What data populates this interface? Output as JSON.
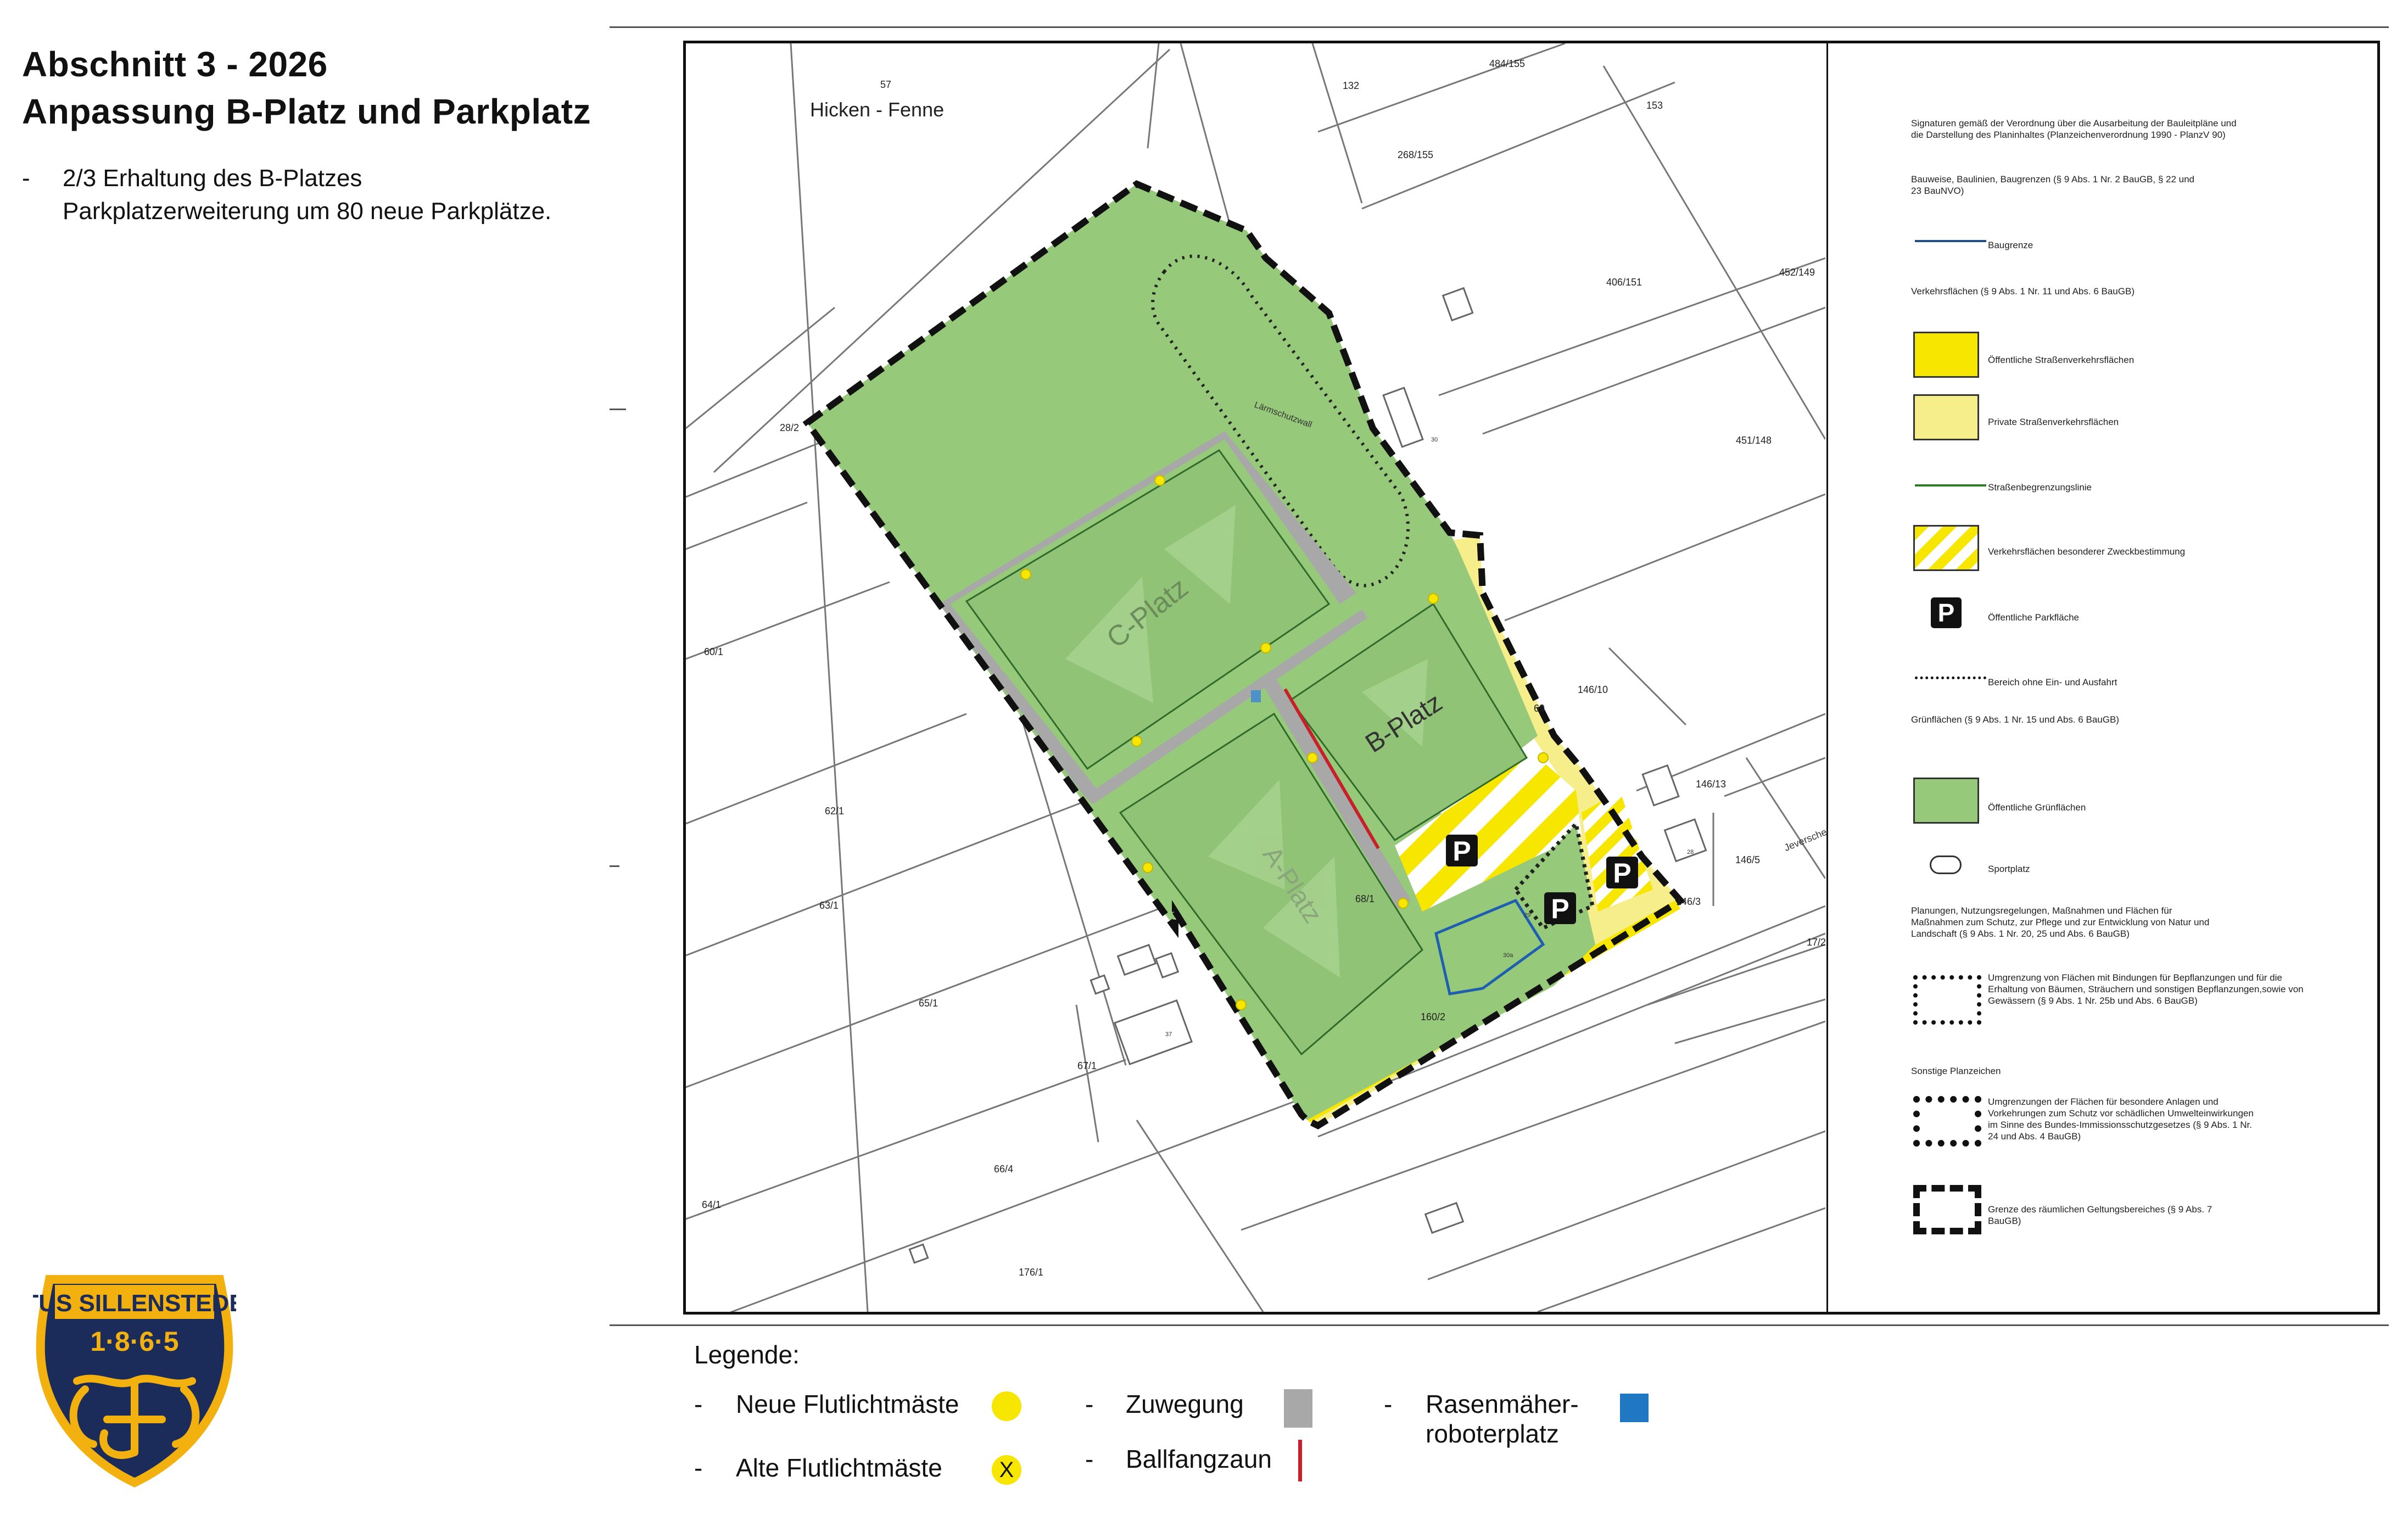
{
  "header": {
    "title_line1": "Abschnitt 3 - 2026",
    "title_line2": "Anpassung B-Platz und Parkplatz",
    "bullet_dash": "-",
    "bullet_line1": "2/3 Erhaltung des B-Platzes",
    "bullet_line2": "Parkplatzerweiterung um 80 neue Parkplätze."
  },
  "map": {
    "location_label": "Hicken - Fenne",
    "fields": {
      "c_platz": "C-Platz",
      "b_platz": "B-Platz",
      "a_platz": "A-Platz"
    },
    "laermschutzwall": "Lärmschutzwall",
    "street_label": "Jeversche",
    "parcels": [
      "57",
      "132",
      "484/155",
      "153",
      "268/155",
      "406/151",
      "452/149",
      "451/148",
      "28/2",
      "60/1",
      "62/1",
      "63/1",
      "65/1",
      "67/1",
      "66/4",
      "64/1",
      "176/1",
      "146/10",
      "69",
      "146/13",
      "146/5",
      "146/3",
      "17/2",
      "68/1",
      "160/2",
      "30",
      "28",
      "37",
      "29",
      "30a"
    ],
    "parking_symbol": "P"
  },
  "plan_legend": {
    "intro": "Signaturen gemäß der Verordnung über die Ausarbeitung der Bauleitpläne und die Darstellung des Planinhaltes (Planzeichenverordnung 1990 - PlanzV 90)",
    "bauweise_heading": "Bauweise, Baulinien, Baugrenzen (§ 9 Abs. 1 Nr. 2 BauGB, § 22 und 23 BauNVO)",
    "baugrenze": "Baugrenze",
    "verkehr_heading": "Verkehrsflächen (§ 9 Abs. 1 Nr. 11 und Abs. 6 BauGB)",
    "oeffentliche_strassen": "Öffentliche Straßenverkehrsflächen",
    "private_strassen": "Private Straßenverkehrsflächen",
    "strassenbegrenzung": "Straßenbegrenzungslinie",
    "besondere_zweck": "Verkehrsflächen besonderer Zweckbestimmung",
    "parkflaeche": "Öffentliche Parkfläche",
    "ohne_einfahrt": "Bereich ohne Ein- und Ausfahrt",
    "gruen_heading": "Grünflächen (§ 9 Abs. 1 Nr. 15 und Abs. 6 BauGB)",
    "oeffentliche_gruen": "Öffentliche Grünflächen",
    "sportplatz": "Sportplatz",
    "planungen_heading": "Planungen, Nutzungsregelungen, Maßnahmen und Flächen für Maßnahmen zum Schutz, zur Pflege und zur Entwicklung von Natur und Landschaft (§ 9 Abs. 1 Nr. 20, 25 und Abs. 6 BauGB)",
    "bindungen": "Umgrenzung von Flächen mit Bindungen für Bepflanzungen und für die Erhaltung von Bäumen, Sträuchern und sonstigen Bepflanzungen,sowie von Gewässern (§ 9 Abs. 1 Nr. 25b und Abs. 6 BauGB)",
    "sonstige_heading": "Sonstige Planzeichen",
    "umgrenzung_anlagen": "Umgrenzungen der Flächen für besondere Anlagen und Vorkehrungen zum Schutz vor schädlichen Umwelteinwirkungen im Sinne des Bundes-Immissionsschutzgesetzes (§ 9 Abs. 1 Nr. 24 und Abs. 4 BauGB)",
    "geltungsbereich": "Grenze des räumlichen Geltungsbereiches (§ 9 Abs. 7 BauGB)"
  },
  "bottom_legend": {
    "title": "Legende:",
    "dash": "-",
    "neue_flutlicht": "Neue Flutlichtmäste",
    "alte_flutlicht": "Alte Flutlichtmäste",
    "alte_symbol": "X",
    "zuwegung": "Zuwegung",
    "ballfangzaun": "Ballfangzaun",
    "rasen_line1": "Rasenmäher-",
    "rasen_line2": "roboterplatz"
  },
  "logo": {
    "line1": "TUS SILLENSTEDE",
    "line2": "1·8·6·5"
  },
  "colors": {
    "green": "#97c97b",
    "yellow": "#f7e600",
    "light_yellow": "#f6ee8a",
    "gray_path": "#a8a8a8",
    "blue_robot": "#1f78c1",
    "red_fence": "#c7202a",
    "logo_navy": "#1c2c5a",
    "logo_gold": "#f2b10f"
  }
}
